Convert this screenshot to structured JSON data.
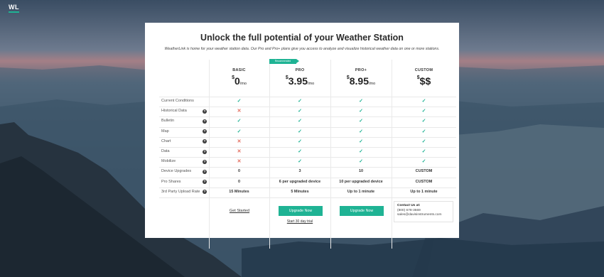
{
  "logo": "WL",
  "title": "Unlock the full potential of your Weather Station",
  "subtitle": "WeatherLink is home for your weather station data. Our Pro and Pro+ plans give you access to analyze and visualize historical weather data on one or more stations.",
  "recommended_badge": "Recommended",
  "plans": [
    {
      "name": "BASIC",
      "currency": "$",
      "amount": "0",
      "period": "/mo"
    },
    {
      "name": "PRO",
      "currency": "$",
      "amount": "3.95",
      "period": "/mo"
    },
    {
      "name": "PRO+",
      "currency": "$",
      "amount": "8.95",
      "period": "/mo"
    },
    {
      "name": "CUSTOM",
      "currency": "$",
      "amount": "$$",
      "period": ""
    }
  ],
  "features": [
    {
      "label": "Current Conditions",
      "help": false,
      "values": [
        "check",
        "check",
        "check",
        "check"
      ]
    },
    {
      "label": "Historical Data",
      "help": true,
      "values": [
        "cross",
        "check",
        "check",
        "check"
      ]
    },
    {
      "label": "Bulletin",
      "help": true,
      "values": [
        "check",
        "check",
        "check",
        "check"
      ]
    },
    {
      "label": "Map",
      "help": true,
      "values": [
        "check",
        "check",
        "check",
        "check"
      ]
    },
    {
      "label": "Chart",
      "help": true,
      "values": [
        "cross",
        "check",
        "check",
        "check"
      ]
    },
    {
      "label": "Data",
      "help": true,
      "values": [
        "cross",
        "check",
        "check",
        "check"
      ]
    },
    {
      "label": "Mobilize",
      "help": true,
      "values": [
        "cross",
        "check",
        "check",
        "check"
      ]
    },
    {
      "label": "Device Upgrades",
      "help": true,
      "values": [
        "0",
        "3",
        "10",
        "CUSTOM"
      ]
    },
    {
      "label": "Pro Shares",
      "help": true,
      "values": [
        "0",
        "6 per upgraded device",
        "10 per upgraded device",
        "CUSTOM"
      ]
    },
    {
      "label": "3rd Party Upload Rate",
      "help": true,
      "values": [
        "15 Minutes",
        "5 Minutes",
        "Up to 1 minute",
        "Up to 1 minute"
      ]
    }
  ],
  "actions": {
    "get_started": "Get Started",
    "upgrade_pro": "Upgrade Now",
    "upgrade_pro_plus": "Upgrade Now",
    "trial": "Start 30 day trial"
  },
  "contact": {
    "heading": "Contact Us at:",
    "phone": "(800) 678-3669",
    "email": "sales@davisinstruments.com"
  },
  "colors": {
    "accent": "#1fb394",
    "cross": "#e46b5c"
  },
  "icons": {
    "check": "✓",
    "cross": "✕",
    "help": "?"
  }
}
